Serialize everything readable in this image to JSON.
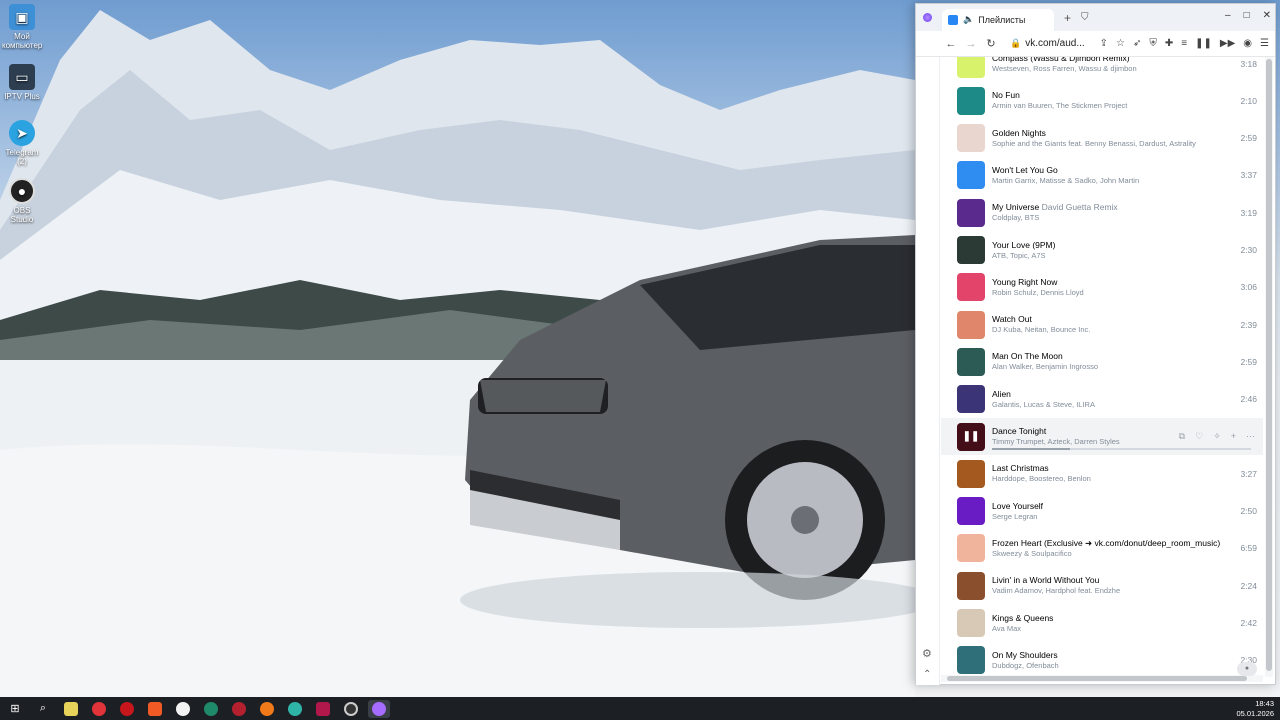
{
  "desktop": {
    "icons": [
      {
        "label": "Мой компьютер"
      },
      {
        "label": "IPTV Plus"
      },
      {
        "label": "Telegram (2)"
      },
      {
        "label": "OBS Studio"
      }
    ]
  },
  "browser": {
    "tab_title": "Плейлисты",
    "url": "vk.com/aud...",
    "window_controls": [
      "–",
      "□",
      "✕"
    ]
  },
  "tracks": [
    {
      "title": "Compass (Wassu & Djimbon Remix)",
      "subtitle": "",
      "artist": "Westseven, Ross Farren, Wassu & djimbon",
      "duration": "3:18",
      "color": "#d8f26b"
    },
    {
      "title": "No Fun",
      "subtitle": "",
      "artist": "Armin van Buuren, The Stickmen Project",
      "duration": "2:10",
      "color": "#1e8a87"
    },
    {
      "title": "Golden Nights",
      "subtitle": "",
      "artist": "Sophie and the Giants feat. Benny Benassi, Dardust, Astrality",
      "duration": "2:59",
      "color": "#e9d6cf"
    },
    {
      "title": "Won't Let You Go",
      "subtitle": "",
      "artist": "Martin Garrix, Matisse & Sadko, John Martin",
      "duration": "3:37",
      "color": "#2f8cf0"
    },
    {
      "title": "My Universe",
      "subtitle": "David Guetta Remix",
      "artist": "Coldplay, BTS",
      "duration": "3:19",
      "color": "#5a2b8c"
    },
    {
      "title": "Your Love (9PM)",
      "subtitle": "",
      "artist": "ATB, Topic, A7S",
      "duration": "2:30",
      "color": "#2b3a35"
    },
    {
      "title": "Young Right Now",
      "subtitle": "",
      "artist": "Robin Schulz, Dennis Lloyd",
      "duration": "3:06",
      "color": "#e2446a"
    },
    {
      "title": "Watch Out",
      "subtitle": "",
      "artist": "DJ Kuba, Neitan, Bounce Inc.",
      "duration": "2:39",
      "color": "#e0866a"
    },
    {
      "title": "Man On The Moon",
      "subtitle": "",
      "artist": "Alan Walker, Benjamin Ingrosso",
      "duration": "2:59",
      "color": "#2c5a55"
    },
    {
      "title": "Alien",
      "subtitle": "",
      "artist": "Galantis, Lucas & Steve, ILIRA",
      "duration": "2:46",
      "color": "#3b3476"
    },
    {
      "title": "Dance Tonight",
      "subtitle": "",
      "artist": "Timmy Trumpet, Azteck, Darren Styles",
      "duration": "",
      "color": "#7a1b2c",
      "active": true
    },
    {
      "title": "Last Christmas",
      "subtitle": "",
      "artist": "Harddope, Boostereo, Benlon",
      "duration": "3:27",
      "color": "#a4591e"
    },
    {
      "title": "Love Yourself",
      "subtitle": "",
      "artist": "Serge Legran",
      "duration": "2:50",
      "color": "#6a1cc4"
    },
    {
      "title": "Frozen Heart (Exclusive ➜ vk.com/donut/deep_room_music)",
      "subtitle": "",
      "artist": "Skweezy & Soulpacifico",
      "duration": "6:59",
      "color": "#f0b49c"
    },
    {
      "title": "Livin' in a World Without You",
      "subtitle": "",
      "artist": "Vadim Adamov, Hardphol feat. Endzhe",
      "duration": "2:24",
      "color": "#8a4f2c"
    },
    {
      "title": "Kings & Queens",
      "subtitle": "",
      "artist": "Ava Max",
      "duration": "2:42",
      "color": "#d8c9b6"
    },
    {
      "title": "On My Shoulders",
      "subtitle": "",
      "artist": "Dubdogz, Ofenbach",
      "duration": "2:30",
      "color": "#2f6f7a"
    }
  ],
  "active_progress": 0.3,
  "clock": {
    "time": "18:43",
    "date": "05.01.2026"
  }
}
